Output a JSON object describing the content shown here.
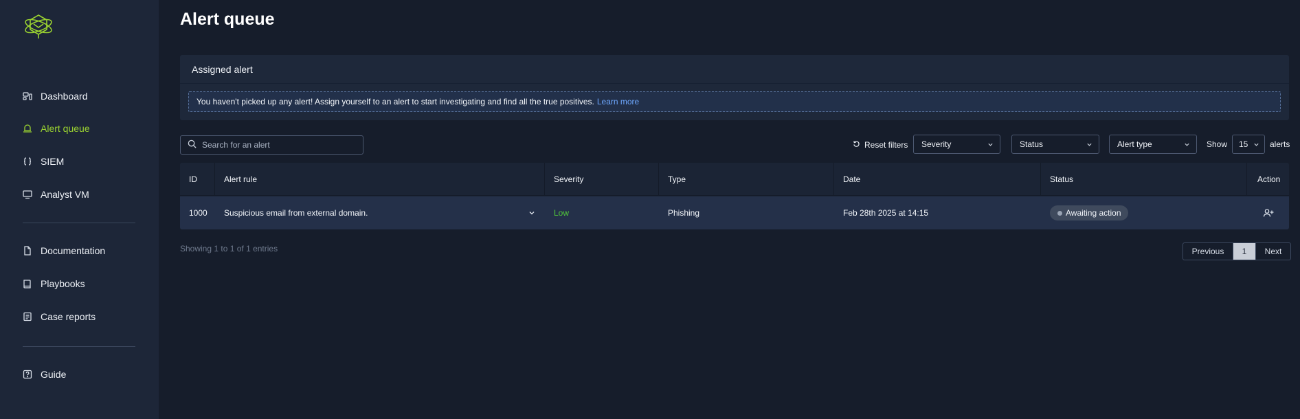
{
  "sidebar": {
    "items": [
      {
        "label": "Dashboard",
        "icon": "dashboard-icon",
        "active": false
      },
      {
        "label": "Alert queue",
        "icon": "alert-queue-icon",
        "active": true
      },
      {
        "label": "SIEM",
        "icon": "siem-braces-icon",
        "active": false
      },
      {
        "label": "Analyst VM",
        "icon": "monitor-icon",
        "active": false
      },
      {
        "label": "Documentation",
        "icon": "document-icon",
        "active": false
      },
      {
        "label": "Playbooks",
        "icon": "book-icon",
        "active": false
      },
      {
        "label": "Case reports",
        "icon": "case-report-icon",
        "active": false
      },
      {
        "label": "Guide",
        "icon": "help-icon",
        "active": false
      }
    ]
  },
  "page": {
    "title": "Alert queue"
  },
  "assigned": {
    "header": "Assigned alert",
    "notice": "You haven't picked up any alert! Assign yourself to an alert to start investigating and find all the true positives.",
    "link": "Learn more"
  },
  "toolbar": {
    "search_placeholder": "Search for an alert",
    "reset_filters": "Reset filters",
    "severity": "Severity",
    "status": "Status",
    "alert_type": "Alert type",
    "show_label": "Show",
    "page_size": "15",
    "alerts_label": "alerts"
  },
  "table": {
    "columns": [
      "ID",
      "Alert rule",
      "Severity",
      "Type",
      "Date",
      "Status",
      "Action"
    ],
    "rows": [
      {
        "id": "1000",
        "rule": "Suspicious email from external domain.",
        "severity": "Low",
        "type": "Phishing",
        "date": "Feb 28th 2025 at 14:15",
        "status": "Awaiting action"
      }
    ]
  },
  "footer": {
    "showing": "Showing 1 to 1 of 1 entries",
    "previous": "Previous",
    "page": "1",
    "next": "Next"
  },
  "colors": {
    "accent": "#9bd331",
    "link": "#6ea8ff",
    "severity_low": "#52c93a",
    "background": "#161d2b",
    "sidebar": "#1d2638"
  }
}
